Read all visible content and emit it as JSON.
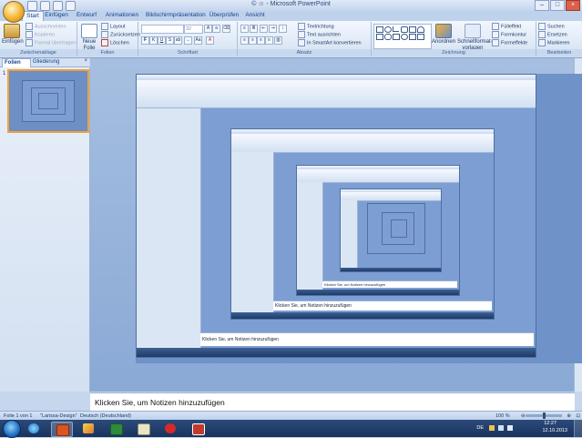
{
  "window": {
    "title": "© ☺ - Microsoft PowerPoint",
    "controls": [
      "–",
      "□",
      "×"
    ]
  },
  "ribbon_tabs": [
    "Start",
    "Einfügen",
    "Entwurf",
    "Animationen",
    "Bildschirmpräsentation",
    "Überprüfen",
    "Ansicht"
  ],
  "ribbon": {
    "zwischenablage": {
      "label": "Zwischenablage",
      "paste": "Einfügen",
      "cut": "Ausschneiden",
      "copy": "Kopieren",
      "format": "Format übertragen"
    },
    "folien": {
      "label": "Folien",
      "new_slide": "Neue Folie",
      "layout": "Layout",
      "reset": "Zurücksetzen",
      "delete": "Löschen"
    },
    "schriftart": {
      "label": "Schriftart",
      "size": "32"
    },
    "absatz": {
      "label": "Absatz",
      "text_direction": "Textrichtung",
      "align_text": "Text ausrichten",
      "smartart": "In SmartArt konvertieren"
    },
    "zeichnung": {
      "label": "Zeichnung",
      "arrange": "Anordnen",
      "quick_styles": "Schnellformat-vorlagen",
      "fill": "Fülleffekt",
      "outline": "Formkontur",
      "effects": "Formeffekte"
    },
    "bearbeiten": {
      "label": "Bearbeiten",
      "find": "Suchen",
      "replace": "Ersetzen",
      "select": "Markieren"
    }
  },
  "panel": {
    "tabs": [
      "Folien",
      "Gliederung"
    ],
    "close": "×",
    "slide_number": "1"
  },
  "notes": {
    "placeholder": "Klicken Sie, um Notizen hinzuzufügen"
  },
  "status": {
    "slide": "Folie 1 von 1",
    "theme": "\"Larissa-Design\"",
    "language": "Deutsch (Deutschland)",
    "zoom": "100 %",
    "zoom_level_percent": 100
  },
  "taskbar": {
    "language": "DE",
    "time": "12:27",
    "date": "12.10.2013"
  },
  "icons": {
    "office_button": "office-orb-icon",
    "start": "windows-start-icon",
    "apps": [
      "internet-explorer-icon",
      "powerpoint-icon",
      "paint-icon",
      "excel-icon",
      "notepad-icon",
      "pdf-icon"
    ]
  },
  "colors": {
    "accent": "#f0a13b",
    "ribbon": "#dde8f6",
    "workspace": "#8aa9d5",
    "taskbar": "#1e3a68"
  }
}
